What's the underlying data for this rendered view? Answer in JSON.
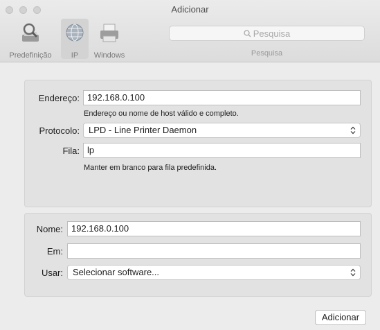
{
  "window": {
    "title": "Adicionar"
  },
  "toolbar": {
    "items": [
      {
        "label": "Predefinição",
        "icon": "magnifier-printer-icon"
      },
      {
        "label": "IP",
        "icon": "globe-icon",
        "selected": true
      },
      {
        "label": "Windows",
        "icon": "printer-icon"
      }
    ],
    "search": {
      "placeholder": "Pesquisa",
      "label": "Pesquisa",
      "icon": "search-icon"
    }
  },
  "printer_panel": {
    "address_label": "Endereço:",
    "address_value": "192.168.0.100",
    "address_hint": "Endereço ou nome de host válido e completo.",
    "protocol_label": "Protocolo:",
    "protocol_value": "LPD - Line Printer Daemon",
    "queue_label": "Fila:",
    "queue_value": "lp",
    "queue_hint": "Manter em branco para fila predefinida."
  },
  "info_panel": {
    "name_label": "Nome:",
    "name_value": "192.168.0.100",
    "location_label": "Em:",
    "location_value": "",
    "use_label": "Usar:",
    "use_value": "Selecionar software..."
  },
  "add_button": "Adicionar"
}
